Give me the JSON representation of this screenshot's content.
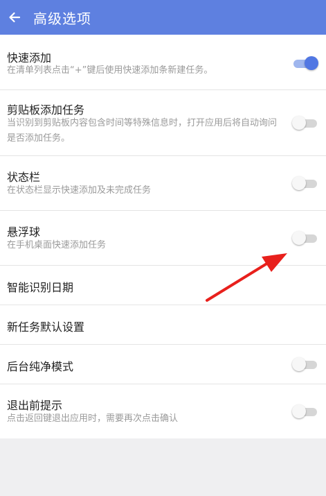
{
  "header": {
    "title": "高级选项",
    "back_icon": "arrow-left-icon"
  },
  "settings": [
    {
      "title": "快速添加",
      "subtitle": "在清单列表点击“+”键后使用快速添加条新建任务。",
      "toggle": true,
      "on": true
    },
    {
      "title": "剪贴板添加任务",
      "subtitle": "当识别到剪贴板内容包含时间等特殊信息时，打开应用后将自动询问是否添加任务。",
      "toggle": true,
      "on": false
    },
    {
      "title": "状态栏",
      "subtitle": "在状态栏显示快速添加及未完成任务",
      "toggle": true,
      "on": false
    },
    {
      "title": "悬浮球",
      "subtitle": "在手机桌面快速添加任务",
      "toggle": true,
      "on": false
    },
    {
      "title": "智能识别日期",
      "subtitle": "",
      "toggle": false
    },
    {
      "title": "新任务默认设置",
      "subtitle": "",
      "toggle": false
    },
    {
      "title": "后台纯净模式",
      "subtitle": "",
      "toggle": true,
      "on": false
    },
    {
      "title": "退出前提示",
      "subtitle": "点击返回键退出应用时，需要再次点击确认",
      "toggle": true,
      "on": false
    }
  ],
  "colors": {
    "appbar": "#5e80e0",
    "accent": "#5177e3",
    "annotation_arrow": "#e8201c"
  }
}
